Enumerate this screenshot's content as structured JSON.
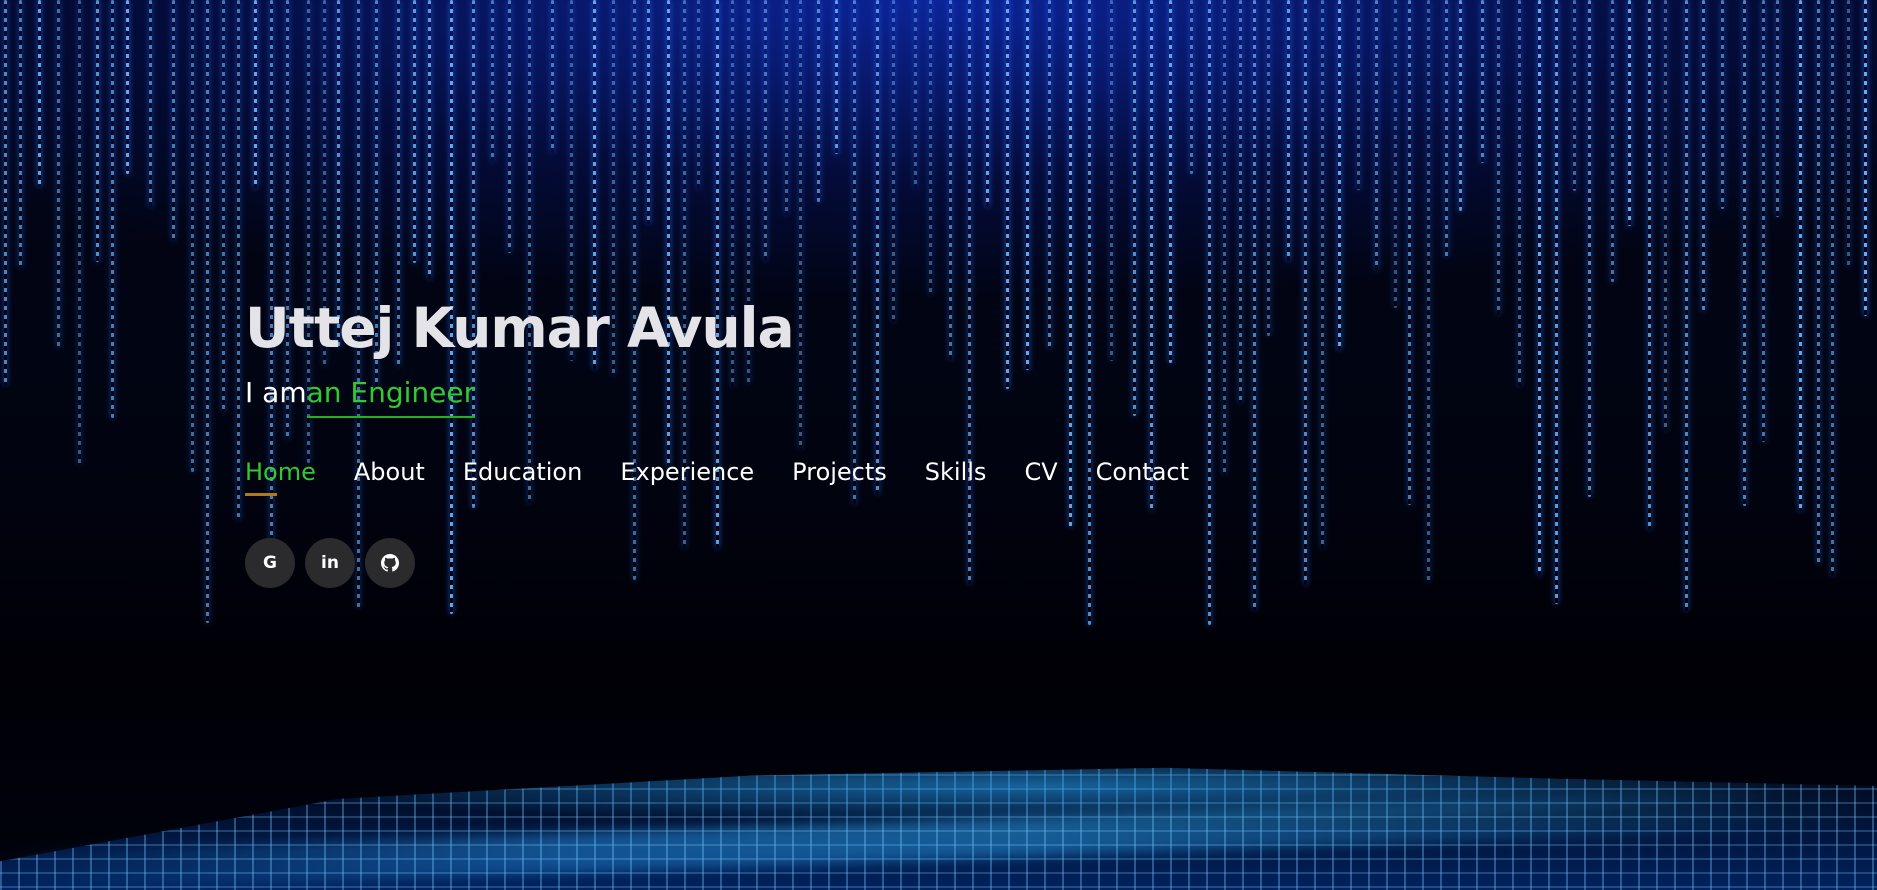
{
  "hero": {
    "name": "Uttej Kumar Avula",
    "tagline_prefix": "I am",
    "tagline_typed": " an Engineer"
  },
  "nav": {
    "items": [
      {
        "label": "Home",
        "active": true
      },
      {
        "label": "About"
      },
      {
        "label": "Education"
      },
      {
        "label": "Experience"
      },
      {
        "label": "Projects"
      },
      {
        "label": "Skills"
      },
      {
        "label": "CV"
      },
      {
        "label": "Contact"
      }
    ]
  },
  "socials": [
    {
      "icon": "google-icon",
      "glyph": "G"
    },
    {
      "icon": "linkedin-icon",
      "glyph": "in"
    },
    {
      "icon": "github-icon",
      "glyph": ""
    }
  ],
  "colors": {
    "accent_green": "#32c832",
    "active_underline": "#b07a1a",
    "name_text": "#e4e4e8",
    "social_bg": "#2b2b2e"
  }
}
